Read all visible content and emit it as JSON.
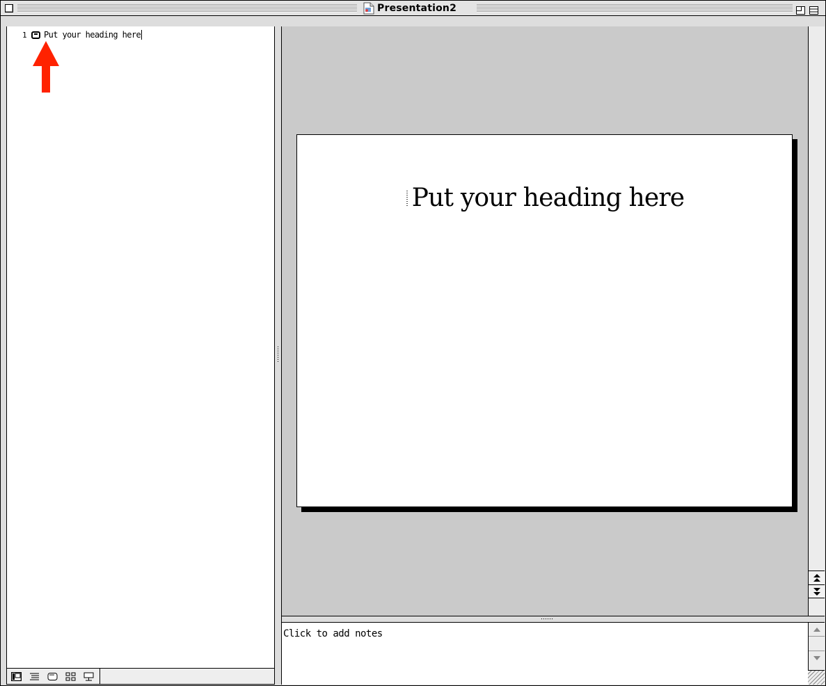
{
  "window": {
    "title": "Presentation2"
  },
  "outline": {
    "slides": [
      {
        "number": "1",
        "title": "Put your heading here"
      }
    ]
  },
  "slide": {
    "title": "Put your heading here"
  },
  "notes": {
    "placeholder": "Click to add notes"
  },
  "view_buttons": {
    "normal": "normal-view-icon",
    "outline": "outline-view-icon",
    "slide": "slide-view-icon",
    "sorter": "slide-sorter-icon",
    "show": "slide-show-icon"
  },
  "scrollbar": {
    "prev_slide": "▲",
    "next_slide": "▼"
  },
  "annotation": {
    "arrow_color": "#ff2200"
  }
}
